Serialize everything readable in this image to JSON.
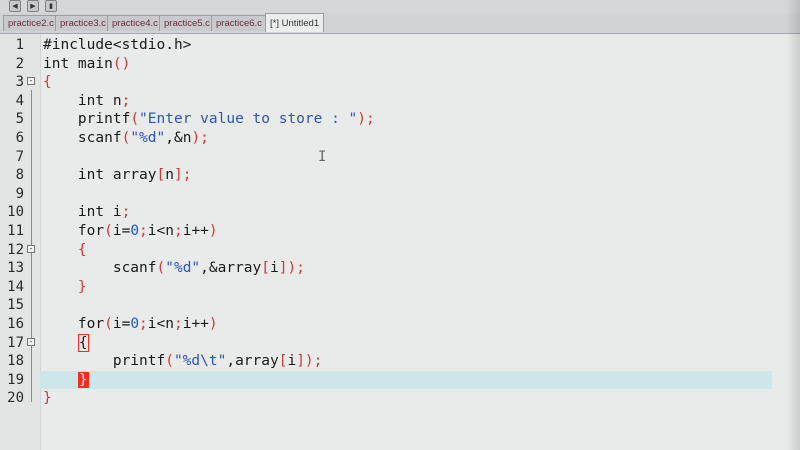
{
  "tabs": [
    {
      "label": "practice2.c",
      "active": false
    },
    {
      "label": "practice3.c",
      "active": false
    },
    {
      "label": "practice4.c",
      "active": false
    },
    {
      "label": "practice5.c",
      "active": false
    },
    {
      "label": "practice6.c",
      "active": false
    },
    {
      "label": "[*] Untitled1",
      "active": true
    }
  ],
  "toolbar": {
    "icons": [
      "back-icon",
      "forward-icon",
      "bookmark-icon"
    ]
  },
  "editor": {
    "current_line": 19,
    "lines": [
      {
        "n": "1",
        "segs": [
          [
            "",
            "#include<stdio.h>"
          ]
        ]
      },
      {
        "n": "2",
        "segs": [
          [
            "kw",
            "int main"
          ],
          [
            "br",
            "()"
          ]
        ]
      },
      {
        "n": "3",
        "segs": [
          [
            "br",
            "{"
          ]
        ],
        "fold": "⊟"
      },
      {
        "n": "4",
        "segs": [
          [
            "",
            "    int n"
          ],
          [
            "br",
            ";"
          ]
        ]
      },
      {
        "n": "5",
        "segs": [
          [
            "",
            "    printf"
          ],
          [
            "br",
            "("
          ],
          [
            "str",
            "\"Enter value to store : \""
          ],
          [
            "br",
            ");"
          ]
        ]
      },
      {
        "n": "6",
        "segs": [
          [
            "",
            "    scanf"
          ],
          [
            "br",
            "("
          ],
          [
            "str",
            "\"%d\""
          ],
          [
            "",
            ",&n"
          ],
          [
            "br",
            ");"
          ]
        ]
      },
      {
        "n": "7",
        "segs": [
          [
            "",
            ""
          ]
        ]
      },
      {
        "n": "8",
        "segs": [
          [
            "",
            "    int array"
          ],
          [
            "br",
            "["
          ],
          [
            "",
            "n"
          ],
          [
            "br",
            "];"
          ]
        ]
      },
      {
        "n": "9",
        "segs": [
          [
            "",
            ""
          ]
        ]
      },
      {
        "n": "10",
        "segs": [
          [
            "",
            "    int i"
          ],
          [
            "br",
            ";"
          ]
        ]
      },
      {
        "n": "11",
        "segs": [
          [
            "",
            "    for"
          ],
          [
            "br",
            "("
          ],
          [
            "",
            "i="
          ],
          [
            "str",
            "0"
          ],
          [
            "br",
            ";"
          ],
          [
            "",
            "i<n"
          ],
          [
            "br",
            ";"
          ],
          [
            "",
            "i++"
          ],
          [
            "br",
            ")"
          ]
        ]
      },
      {
        "n": "12",
        "segs": [
          [
            "br",
            "    {"
          ]
        ],
        "fold": "⊟"
      },
      {
        "n": "13",
        "segs": [
          [
            "",
            "        scanf"
          ],
          [
            "br",
            "("
          ],
          [
            "str",
            "\"%d\""
          ],
          [
            "",
            ",&array"
          ],
          [
            "br",
            "["
          ],
          [
            "",
            "i"
          ],
          [
            "br",
            "]);"
          ]
        ]
      },
      {
        "n": "14",
        "segs": [
          [
            "br",
            "    }"
          ]
        ]
      },
      {
        "n": "15",
        "segs": [
          [
            "",
            ""
          ]
        ]
      },
      {
        "n": "16",
        "segs": [
          [
            "",
            "    for"
          ],
          [
            "br",
            "("
          ],
          [
            "",
            "i="
          ],
          [
            "str",
            "0"
          ],
          [
            "br",
            ";"
          ],
          [
            "",
            "i<n"
          ],
          [
            "br",
            ";"
          ],
          [
            "",
            "i++"
          ],
          [
            "br",
            ")"
          ]
        ]
      },
      {
        "n": "17",
        "segs": [
          [
            "",
            "    "
          ],
          [
            "brace-box",
            "{"
          ]
        ],
        "fold": "⊟"
      },
      {
        "n": "18",
        "segs": [
          [
            "",
            "        printf"
          ],
          [
            "br",
            "("
          ],
          [
            "str",
            "\"%d\\t\""
          ],
          [
            "",
            ",array"
          ],
          [
            "br",
            "["
          ],
          [
            "",
            "i"
          ],
          [
            "br",
            "]);"
          ]
        ]
      },
      {
        "n": "19",
        "segs": [
          [
            "",
            "    "
          ],
          [
            "caret-brace",
            "}"
          ]
        ]
      },
      {
        "n": "20",
        "segs": [
          [
            "br",
            "}"
          ]
        ]
      }
    ]
  }
}
